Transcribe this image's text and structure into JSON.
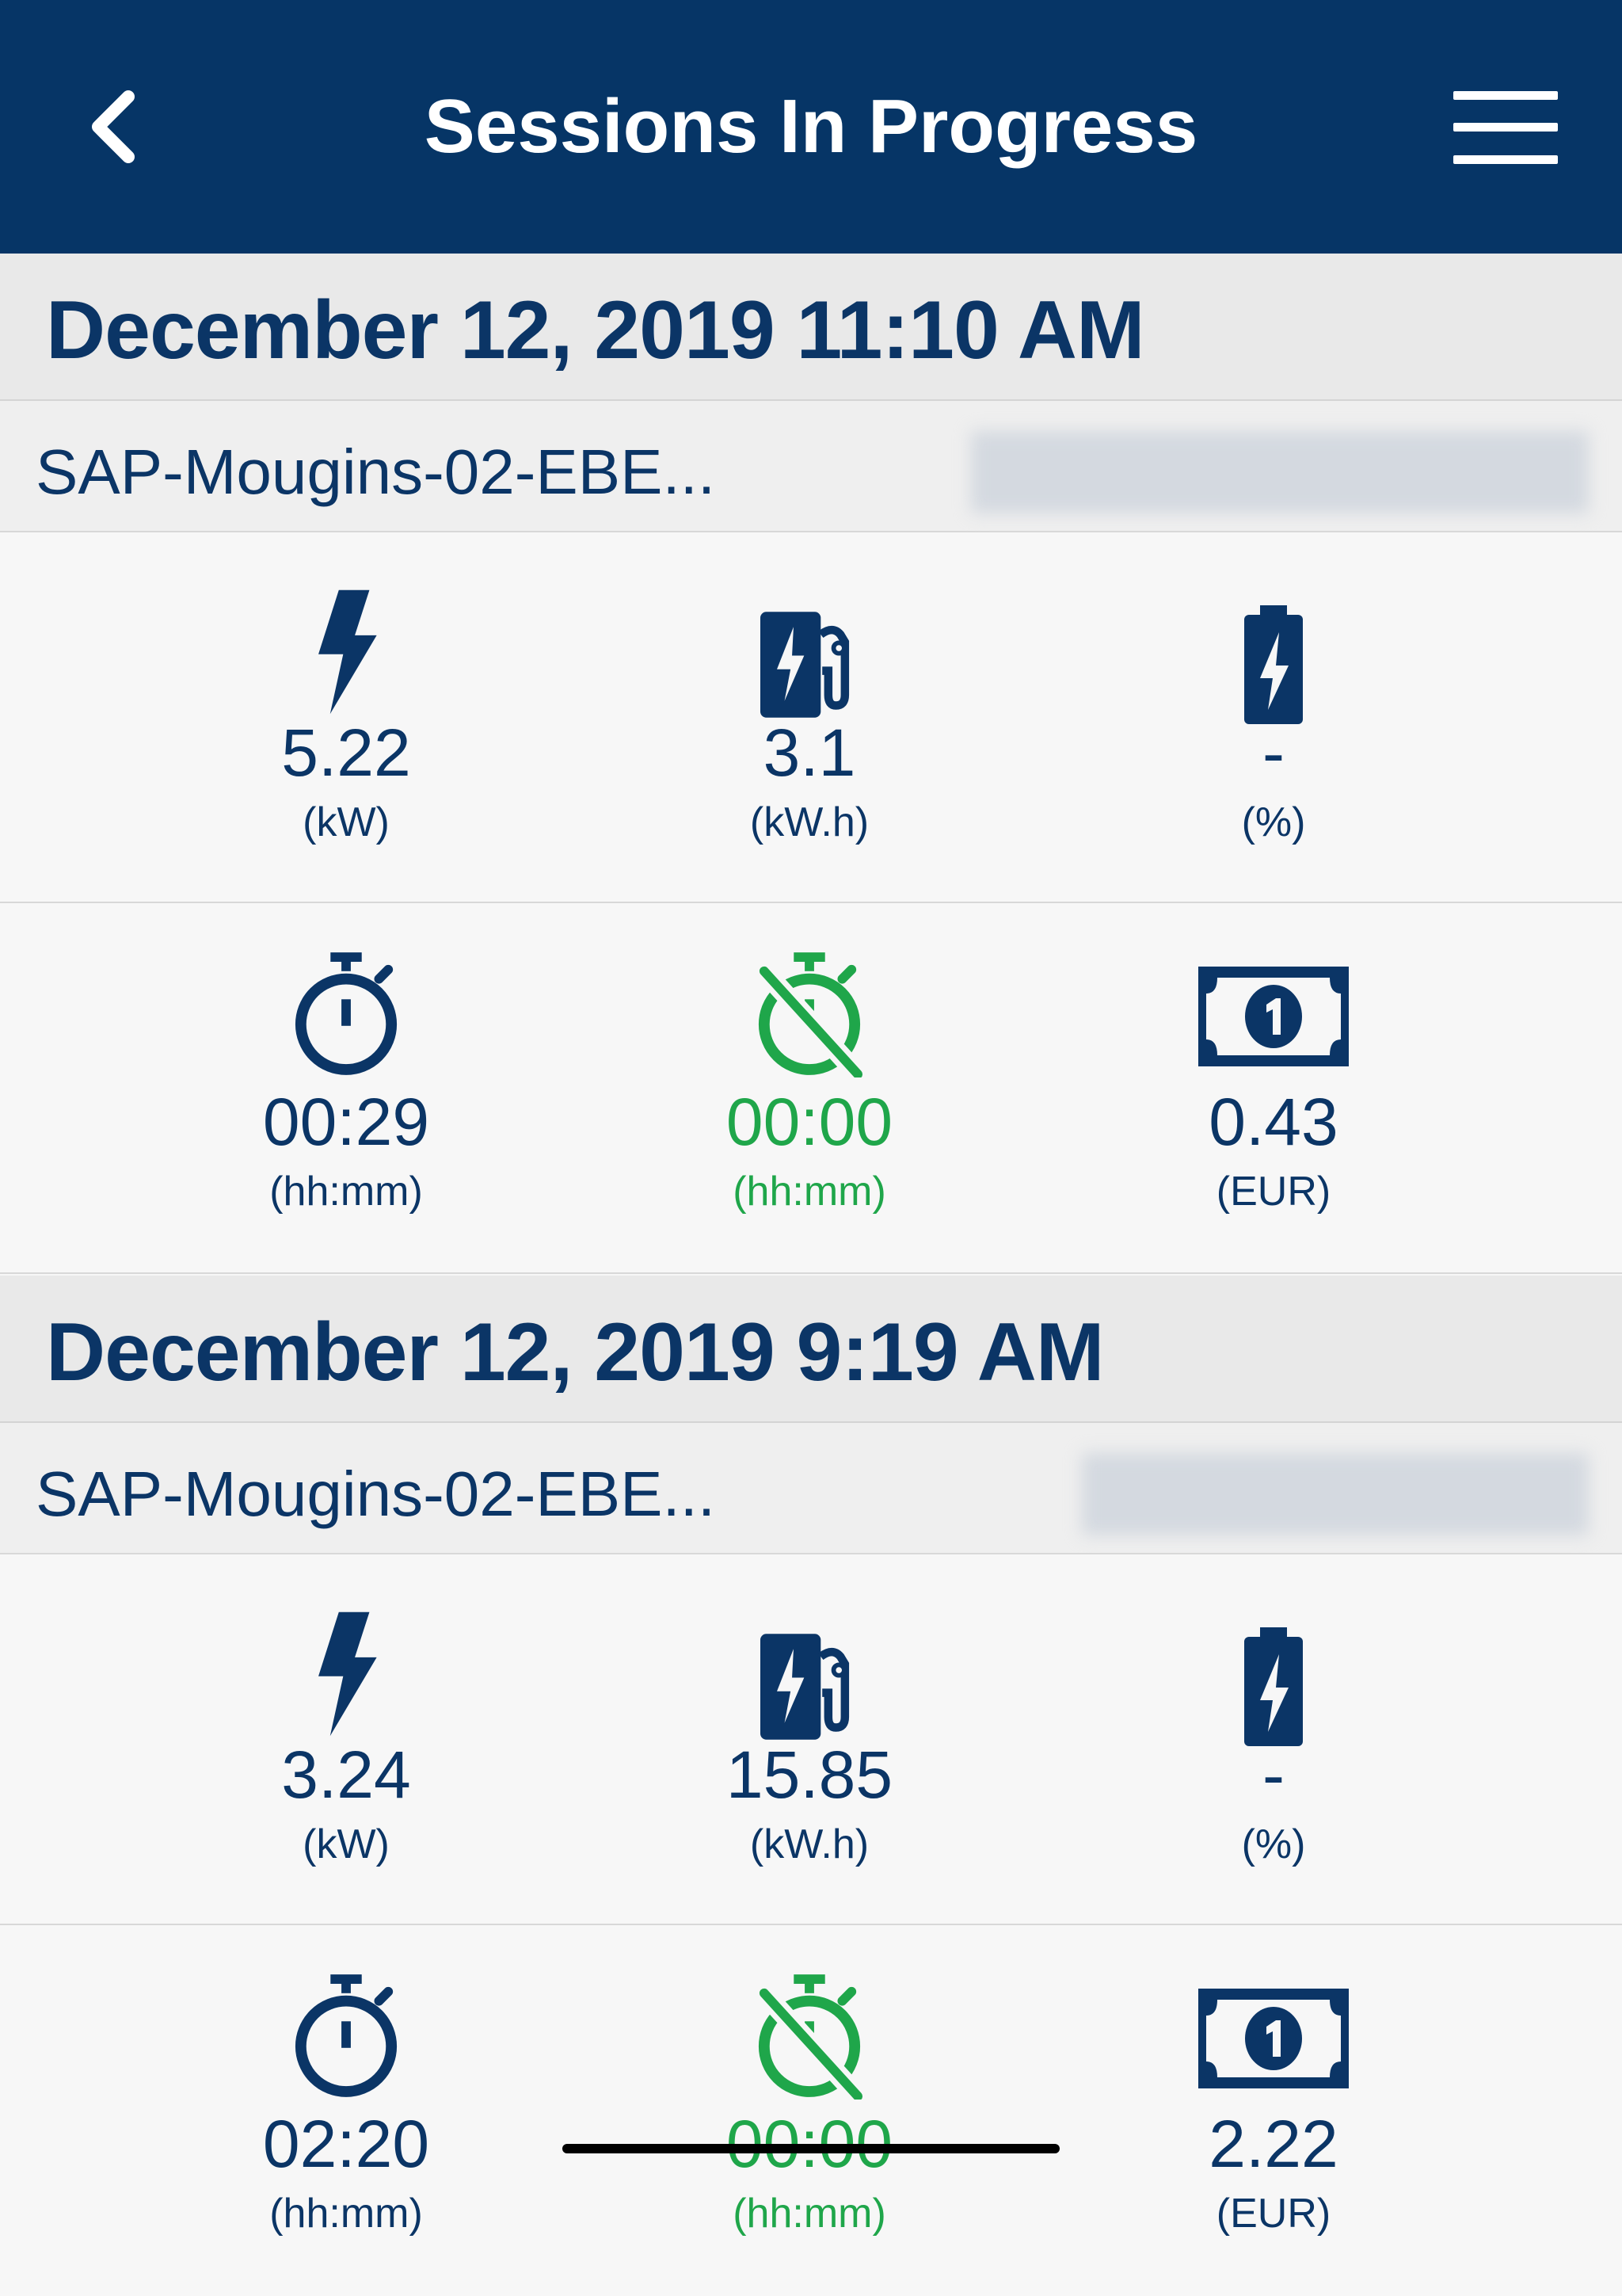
{
  "header": {
    "title": "Sessions In Progress",
    "back_icon": "chevron-left-icon",
    "menu_icon": "hamburger-menu-icon"
  },
  "colors": {
    "header_bg": "#063566",
    "primary_text": "#0b3566",
    "accent_green": "#1fa64a"
  },
  "sessions": [
    {
      "date": "December 12, 2019 11:10 AM",
      "station": "SAP-Mougins-02-EBE...",
      "power": {
        "value": "5.22",
        "unit": "(kW)"
      },
      "energy": {
        "value": "3.1",
        "unit": "(kW.h)"
      },
      "battery": {
        "value": "-",
        "unit": "(%)"
      },
      "duration": {
        "value": "00:29",
        "unit": "(hh:mm)"
      },
      "idle": {
        "value": "00:00",
        "unit": "(hh:mm)"
      },
      "cost": {
        "value": "0.43",
        "unit": "(EUR)"
      }
    },
    {
      "date": "December 12, 2019 9:19 AM",
      "station": "SAP-Mougins-02-EBE...",
      "power": {
        "value": "3.24",
        "unit": "(kW)"
      },
      "energy": {
        "value": "15.85",
        "unit": "(kW.h)"
      },
      "battery": {
        "value": "-",
        "unit": "(%)"
      },
      "duration": {
        "value": "02:20",
        "unit": "(hh:mm)"
      },
      "idle": {
        "value": "00:00",
        "unit": "(hh:mm)"
      },
      "cost": {
        "value": "2.22",
        "unit": "(EUR)"
      }
    }
  ]
}
